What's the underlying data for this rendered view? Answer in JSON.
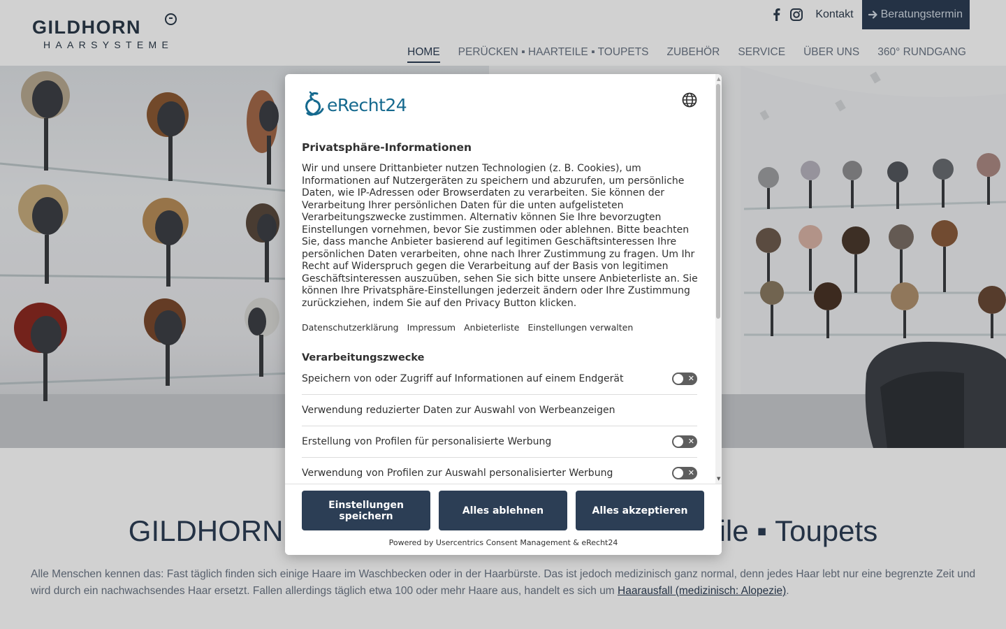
{
  "colors": {
    "primary": "#2c3e55",
    "logo_text": "#2b3a4a",
    "nav_text": "#6b7685",
    "erecht_brand": "#15698e",
    "toggle_off": "#5e5e5e"
  },
  "header": {
    "logo": {
      "main": "GILDHORN",
      "sub": "HAARSYSTEME"
    },
    "icons": {
      "facebook": "facebook-icon",
      "instagram": "instagram-icon",
      "arrow": "arrow-right-icon"
    },
    "kontakt": "Kontakt",
    "cta": "Beratungstermin",
    "nav": [
      "HOME",
      "PERÜCKEN ▪ HAARTEILE ▪ TOUPETS",
      "ZUBEHÖR",
      "SERVICE",
      "ÜBER UNS",
      "360° RUNDGANG"
    ],
    "active_nav": "HOME"
  },
  "content": {
    "title": "GILDHORN Haarsysteme: Perücken ▪ Haarteile ▪ Toupets",
    "paragraph": "Alle Menschen kennen das: Fast täglich finden sich einige Haare im Waschbecken oder in der Haarbürste. Das ist jedoch medizinisch ganz normal, denn jedes Haar lebt nur eine begrenzte Zeit und wird durch ein nachwachsendes Haar ersetzt. Fallen allerdings täglich etwa 100 oder mehr Haare aus, handelt es sich um ",
    "link": "Haarausfall (medizinisch: Alopezie)",
    "after_link": "."
  },
  "modal": {
    "brand": "eRecht24",
    "icons": {
      "language": "globe-icon"
    },
    "title": "Privatsphäre-Informationen",
    "description": "Wir und unsere Drittanbieter nutzen Technologien (z. B. Cookies), um Informationen auf Nutzergeräten zu speichern und abzurufen, um persönliche Daten, wie IP-Adressen oder Browserdaten zu verarbeiten. Sie können der Verarbeitung Ihrer persönlichen Daten für die unten aufgelisteten Verarbeitungszwecke zustimmen. Alternativ können Sie Ihre bevorzugten Einstellungen vornehmen, bevor Sie zustimmen oder ablehnen. Bitte beachten Sie, dass manche Anbieter basierend auf legitimen Geschäftsinteressen Ihre persönlichen Daten verarbeiten, ohne nach Ihrer Zustimmung zu fragen. Um Ihr Recht auf Widerspruch gegen die Verarbeitung auf der Basis von legitimen Geschäftsinteressen auszuüben, sehen Sie sich bitte unsere Anbieterliste an. Sie können Ihre Privatsphäre-Einstellungen jederzeit ändern oder Ihre Zustimmung zurückziehen, indem Sie auf den Privacy Button klicken.",
    "links": [
      "Datenschutzerklärung",
      "Impressum",
      "Anbieterliste",
      "Einstellungen verwalten"
    ],
    "purposes_title": "Verarbeitungszwecke",
    "purposes": [
      {
        "label": "Speichern von oder Zugriff auf Informationen auf einem Endgerät",
        "toggle": true,
        "on": false
      },
      {
        "label": "Verwendung reduzierter Daten zur Auswahl von Werbeanzeigen",
        "toggle": false,
        "on": false
      },
      {
        "label": "Erstellung von Profilen für personalisierte Werbung",
        "toggle": true,
        "on": false
      },
      {
        "label": "Verwendung von Profilen zur Auswahl personalisierter Werbung",
        "toggle": true,
        "on": false
      }
    ],
    "toggle_x": "✕",
    "buttons": {
      "save": "Einstellungen speichern",
      "deny": "Alles ablehnen",
      "accept": "Alles akzeptieren"
    },
    "powered_by": "Powered by Usercentrics Consent Management & eRecht24"
  }
}
